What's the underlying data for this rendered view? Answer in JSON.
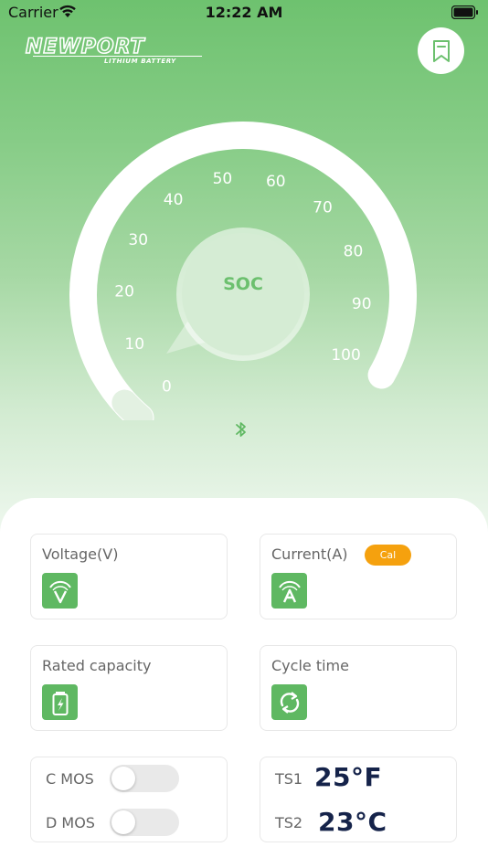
{
  "status_bar": {
    "carrier": "Carrier",
    "time": "12:22 AM"
  },
  "header": {
    "brand": "NEWPORT",
    "brand_sub": "LITHIUM BATTERY",
    "bookmark_icon": "bookmark-icon"
  },
  "gauge": {
    "center_label": "SOC",
    "ticks": [
      "0",
      "10",
      "20",
      "30",
      "40",
      "50",
      "60",
      "70",
      "80",
      "90",
      "100"
    ],
    "value_percent": 0,
    "bluetooth_icon": "bluetooth-icon"
  },
  "cards": {
    "voltage": {
      "title": "Voltage(V)",
      "icon": "voltage-icon"
    },
    "current": {
      "title": "Current(A)",
      "badge": "Cal",
      "icon": "current-icon"
    },
    "rated_capacity": {
      "title": "Rated capacity",
      "icon": "battery-charge-icon"
    },
    "cycle_time": {
      "title": "Cycle time",
      "icon": "cycle-icon"
    }
  },
  "mos": {
    "c_label": "C MOS",
    "d_label": "D MOS",
    "c_on": false,
    "d_on": false
  },
  "temps": {
    "ts1_label": "TS1",
    "ts1_value": "25°F",
    "ts2_label": "TS2",
    "ts2_value": "23°C"
  },
  "colors": {
    "accent_green": "#5fb862",
    "cal_orange": "#f5a10e",
    "temp_text": "#15234a"
  }
}
